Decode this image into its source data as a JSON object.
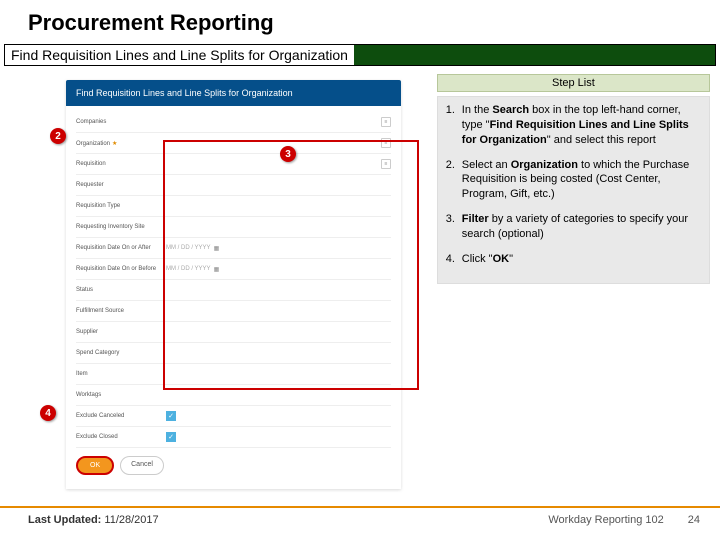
{
  "title": "Procurement Reporting",
  "subtitle": "Find Requisition Lines and Line Splits for Organization",
  "form": {
    "header": "Find Requisition Lines and Line Splits for Organization",
    "rows": {
      "companies": "Companies",
      "organization": "Organization",
      "requisition": "Requisition",
      "requester": "Requester",
      "requisition_type": "Requisition Type",
      "requesting_inventory_site": "Requesting Inventory Site",
      "date_after": "Requisition Date On or After",
      "date_before": "Requisition Date On or Before",
      "status": "Status",
      "fulfillment_source": "Fulfillment Source",
      "supplier": "Supplier",
      "spend_category": "Spend Category",
      "item": "Item",
      "worktags": "Worktags",
      "exclude_canceled": "Exclude Canceled",
      "exclude_closed": "Exclude Closed"
    },
    "date_placeholder": "MM / DD / YYYY",
    "ok": "OK",
    "cancel": "Cancel"
  },
  "callouts": {
    "c2": "2",
    "c3": "3",
    "c4": "4"
  },
  "steps": {
    "header": "Step List",
    "s1a": "In the ",
    "s1b": "Search",
    "s1c": " box in the top left-hand corner, type \"",
    "s1d": "Find Requisition Lines and Line Splits for Organization",
    "s1e": "\" and select this report",
    "s2a": "Select an ",
    "s2b": "Organization",
    "s2c": " to which the Purchase Requisition is being costed (Cost Center, Program, Gift, etc.)",
    "s3a": "Filter",
    "s3b": " by a variety of categories to specify your search (optional)",
    "s4a": "Click \"",
    "s4b": "OK",
    "s4c": "\""
  },
  "footer": {
    "lu_label": "Last Updated:",
    "lu_date": " 11/28/2017",
    "course": "Workday Reporting 102",
    "page": "24"
  }
}
